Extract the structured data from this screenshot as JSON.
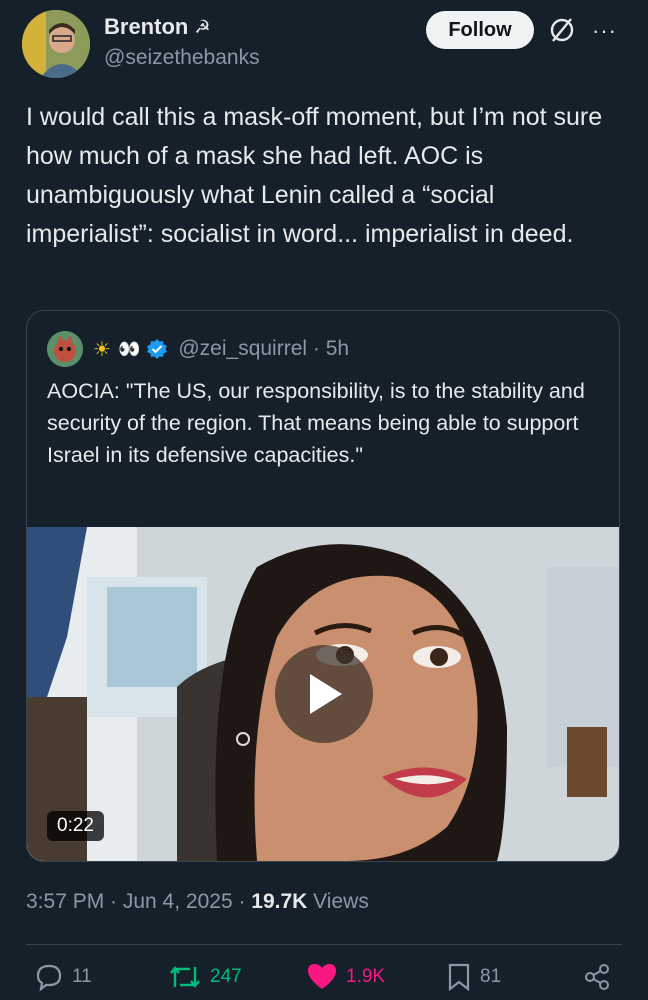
{
  "author": {
    "display_name": "Brenton",
    "badge_icon": "hammer-sickle-icon",
    "handle": "@seizethebanks"
  },
  "header": {
    "follow_label": "Follow",
    "grok_icon": "grok-icon",
    "more_icon": "more-icon"
  },
  "tweet": {
    "text": "I would call this a mask-off moment, but I’m not sure how much of a mask she had left. AOC is unambiguously what Lenin called a “social imperialist”: socialist in word... imperialist in deed."
  },
  "quote": {
    "name_emojis": "☀",
    "name_eyes": "👀",
    "verified_icon": "verified-badge-icon",
    "handle_time": "@zei_squirrel · 5h",
    "text": "AOCIA: \"The US, our responsibility, is to the stability and security of the region. That means being able to support Israel in its defensive capacities.\"",
    "video": {
      "duration": "0:22",
      "play_icon": "play-icon"
    }
  },
  "meta": {
    "time_date": "3:57 PM · Jun 4, 2025 · ",
    "views_count": "19.7K",
    "views_label": " Views"
  },
  "actions": {
    "replies": "11",
    "retweets": "247",
    "likes": "1.9K",
    "bookmarks": "81"
  },
  "colors": {
    "background": "#15202b",
    "text": "#e7e9ea",
    "muted": "#8b98a5",
    "border": "#38444d",
    "retweet": "#00ba7c",
    "like": "#f91880",
    "verified": "#1d9bf0"
  }
}
